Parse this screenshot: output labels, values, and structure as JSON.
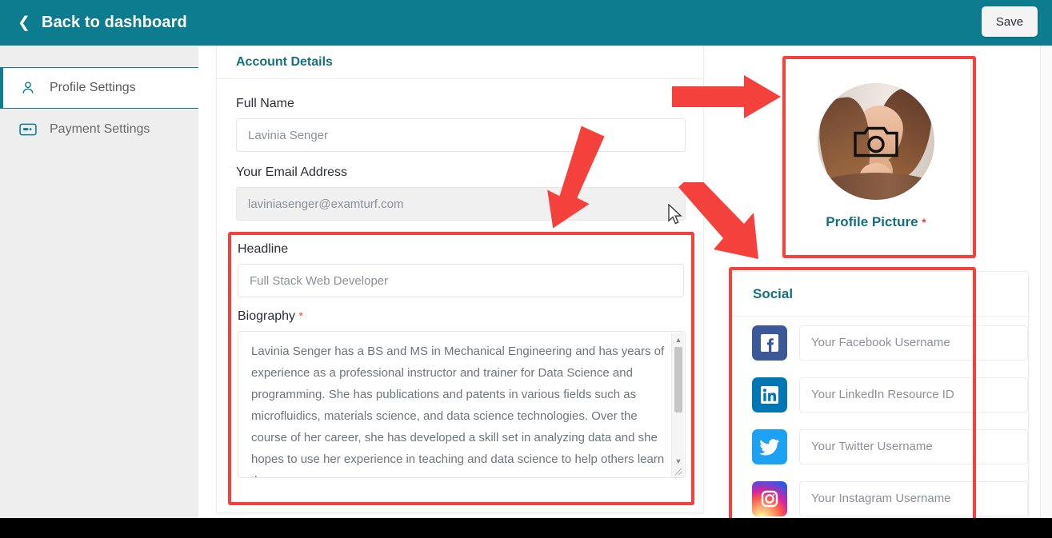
{
  "header": {
    "back_label": "Back to dashboard",
    "back_icon": "chevron-left-icon",
    "save_label": "Save",
    "background_color": "#0d7c8f"
  },
  "sidebar": {
    "items": [
      {
        "label": "Profile Settings",
        "icon": "user-icon",
        "active": true
      },
      {
        "label": "Payment Settings",
        "icon": "credit-card-icon",
        "active": false
      }
    ]
  },
  "account_details": {
    "title": "Account Details",
    "fields": [
      {
        "label": "Full Name",
        "value": "Lavinia Senger",
        "placeholder": "Lavinia Senger",
        "disabled": false,
        "required": false
      },
      {
        "label": "Your Email Address",
        "value": "laviniasenger@examturf.com",
        "placeholder": "laviniasenger@examturf.com",
        "disabled": true,
        "required": false
      },
      {
        "label": "Headline",
        "value": "Full Stack Web Developer",
        "placeholder": "Full Stack Web Developer",
        "disabled": false,
        "required": false
      }
    ],
    "biography": {
      "label": "Biography",
      "required_marker": "*",
      "value": "Lavinia Senger has a BS and MS in Mechanical Engineering and has years of experience as a professional instructor and trainer for Data Science and programming. She has publications and patents in various fields such as microfluidics, materials science, and data science technologies. Over the course of her career, she has developed a skill set in analyzing data and she hopes to use her experience in teaching and data science to help others learn the"
    }
  },
  "profile_picture": {
    "caption": "Profile Picture",
    "required_marker": "*",
    "overlay_icon": "camera-icon"
  },
  "social": {
    "title": "Social",
    "rows": [
      {
        "network": "facebook",
        "icon": "facebook-icon",
        "placeholder": "Your Facebook Username",
        "value": "",
        "color": "#3b5998"
      },
      {
        "network": "linkedin",
        "icon": "linkedin-icon",
        "placeholder": "Your LinkedIn Resource ID",
        "value": "",
        "color": "#0077b5"
      },
      {
        "network": "twitter",
        "icon": "twitter-icon",
        "placeholder": "Your Twitter Username",
        "value": "",
        "color": "#1da1f2"
      },
      {
        "network": "instagram",
        "icon": "instagram-icon",
        "placeholder": "Your Instagram Username",
        "value": "",
        "color": "#d6249f"
      }
    ]
  },
  "annotations": {
    "highlight_color": "#f5413c",
    "boxes": [
      {
        "target": "headline-biography-group"
      },
      {
        "target": "profile-picture-card"
      },
      {
        "target": "social-card"
      }
    ],
    "arrows": [
      {
        "target": "profile-picture-card",
        "direction": "right"
      },
      {
        "target": "headline-biography-group",
        "direction": "down"
      },
      {
        "target": "social-card",
        "direction": "down-right"
      }
    ]
  }
}
